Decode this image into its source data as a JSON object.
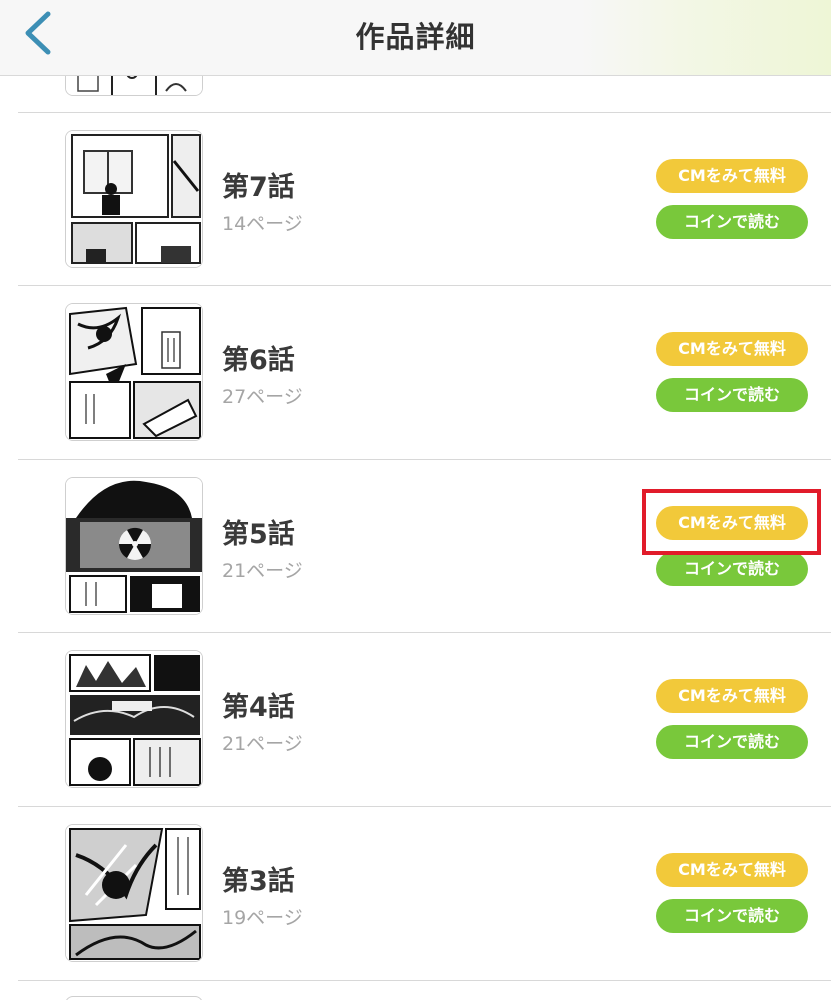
{
  "header": {
    "title": "作品詳細",
    "back_icon": "chevron-left-icon"
  },
  "colors": {
    "cm_button": "#f2c93a",
    "coin_button": "#79c83b",
    "highlight": "#e11b2a",
    "back_chevron": "#3d8fb5"
  },
  "episodes": [
    {
      "title": "第7話",
      "pages": "14ページ",
      "cm_label": "CMをみて無料",
      "coin_label": "コインで読む"
    },
    {
      "title": "第6話",
      "pages": "27ページ",
      "cm_label": "CMをみて無料",
      "coin_label": "コインで読む"
    },
    {
      "title": "第5話",
      "pages": "21ページ",
      "cm_label": "CMをみて無料",
      "coin_label": "コインで読む"
    },
    {
      "title": "第4話",
      "pages": "21ページ",
      "cm_label": "CMをみて無料",
      "coin_label": "コインで読む"
    },
    {
      "title": "第3話",
      "pages": "19ページ",
      "cm_label": "CMをみて無料",
      "coin_label": "コインで読む"
    }
  ]
}
